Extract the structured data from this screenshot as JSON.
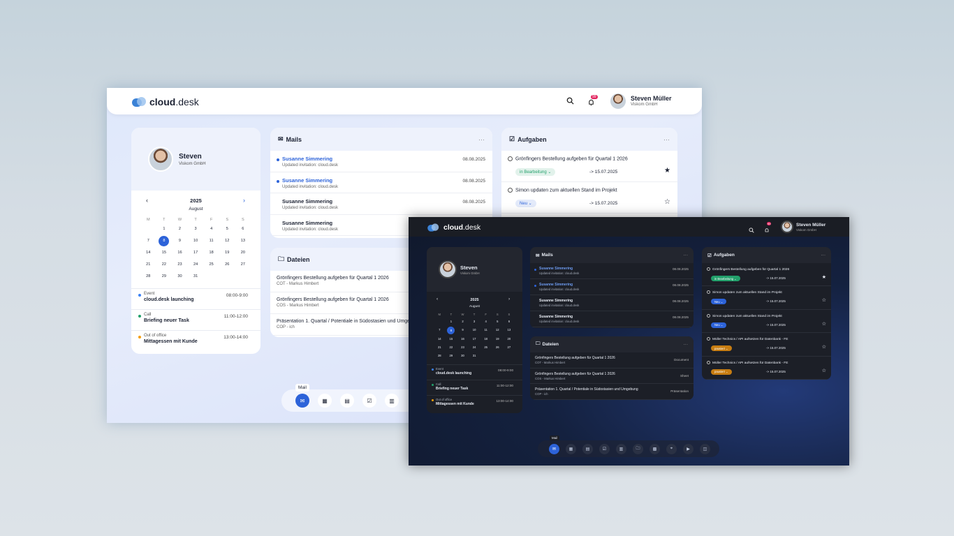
{
  "app": {
    "brand_bold": "cloud",
    "brand_rest": ".desk"
  },
  "user": {
    "name": "Steven Müller",
    "company": "Viskom GmbH",
    "notif_count": "99",
    "short_name": "Steven"
  },
  "calendar": {
    "year": "2025",
    "month": "August",
    "weekdays": [
      "M",
      "T",
      "W",
      "T",
      "F",
      "S",
      "S"
    ],
    "days": [
      "",
      "1",
      "2",
      "3",
      "4",
      "5",
      "6",
      "7",
      "8",
      "9",
      "10",
      "11",
      "12",
      "13",
      "14",
      "15",
      "16",
      "17",
      "18",
      "19",
      "20",
      "21",
      "22",
      "23",
      "24",
      "25",
      "26",
      "27",
      "28",
      "29",
      "30",
      "31",
      "",
      "",
      ""
    ],
    "selected": "8",
    "prev": "‹",
    "next": "›"
  },
  "events": [
    {
      "type": "Event",
      "name": "cloud.desk launching",
      "time": "08:00-9:00",
      "color": "#3b82f6"
    },
    {
      "type": "Call",
      "name": "Briefing neuer Task",
      "time": "11:00-12:00",
      "color": "#22a06b"
    },
    {
      "type": "Out of office",
      "name": "Mittagessen mit Kunde",
      "time": "13:00-14:00",
      "color": "#f59e0b"
    }
  ],
  "mails": {
    "title": "Mails",
    "more": "···",
    "items": [
      {
        "sender": "Susanne Simmering",
        "subject": "Updated invitation: cloud.desk",
        "date": "08.08.2025",
        "unread": true
      },
      {
        "sender": "Susanne Simmering",
        "subject": "Updated invitation: cloud.desk",
        "date": "08.08.2025",
        "unread": true
      },
      {
        "sender": "Susanne Simmering",
        "subject": "Updated invitation: cloud.desk",
        "date": "08.08.2025",
        "unread": false
      },
      {
        "sender": "Susanne Simmering",
        "subject": "Updated invitation: cloud.desk",
        "date": "08.08.2025",
        "unread": false
      }
    ]
  },
  "files": {
    "title": "Dateien",
    "more": "···",
    "items": [
      {
        "name": "Grönfingers Bestellung aufgeben für Quartal 1 2026",
        "meta": "COT - Markus Himbert",
        "kind": "Document"
      },
      {
        "name": "Grönfingers Bestellung aufgeben für Quartal 1 2026",
        "meta": "COS - Markus Himbert",
        "kind": "Sheet"
      },
      {
        "name": "Präsentation 1. Quartal / Potentiale in Südostasien und Umgebung",
        "meta": "COP - ich",
        "kind": "Präsentation"
      }
    ]
  },
  "tasks": {
    "title": "Aufgaben",
    "more": "···",
    "items": [
      {
        "name": "Grönfingers Bestellung aufgeben für Quartal 1 2026",
        "status": "in Bearbeitung",
        "status_color": "#22a06b",
        "due": "-> 15.07.2025",
        "starred": true
      },
      {
        "name": "Simon updaten zum aktuellen Stand im Projekt",
        "status": "Neu",
        "status_color": "#2d63d9",
        "due": "-> 15.07.2025",
        "starred": false
      },
      {
        "name": "Simon updaten zum aktuellen Stand im Projekt",
        "status": "Neu",
        "status_color": "#2d63d9",
        "due": "-> 15.07.2025",
        "starred": false
      },
      {
        "name": "Müller Technics / API aufsetzen für Datenbank - FE",
        "status": "pausiert",
        "status_color": "#c77d12",
        "due": "-> 15.07.2025",
        "starred": false
      },
      {
        "name": "Müller Technics / API aufsetzen für Datenbank - FE",
        "status": "pausiert",
        "status_color": "#c77d12",
        "due": "-> 15.07.2025",
        "starred": false
      }
    ]
  },
  "dock": {
    "tooltip": "Mail",
    "icons_light": [
      "mail-icon",
      "calendar-icon",
      "contacts-icon",
      "tasks-icon",
      "files-icon"
    ],
    "icons_dark": [
      "mail-icon",
      "calendar-icon",
      "contacts-icon",
      "tasks-icon",
      "files-icon",
      "folder-icon",
      "apps-icon",
      "location-icon",
      "video-icon",
      "chat-icon"
    ]
  }
}
